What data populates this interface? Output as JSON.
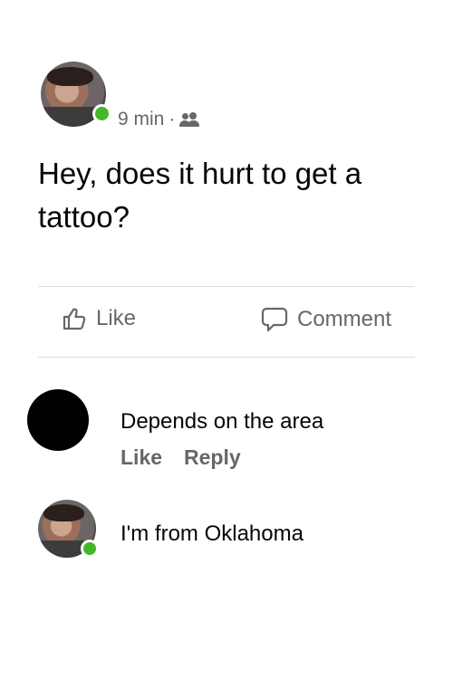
{
  "post": {
    "time": "9 min",
    "separator": "·",
    "audience_icon": "friends-icon",
    "text": "Hey, does it hurt to get a tattoo?"
  },
  "actions": {
    "like_label": "Like",
    "comment_label": "Comment"
  },
  "comments": [
    {
      "text": "Depends on the area",
      "like_label": "Like",
      "reply_label": "Reply"
    },
    {
      "text": "I'm from Oklahoma"
    }
  ],
  "colors": {
    "online": "#42b72a",
    "secondary_text": "#65676b",
    "divider": "#dadde1"
  }
}
